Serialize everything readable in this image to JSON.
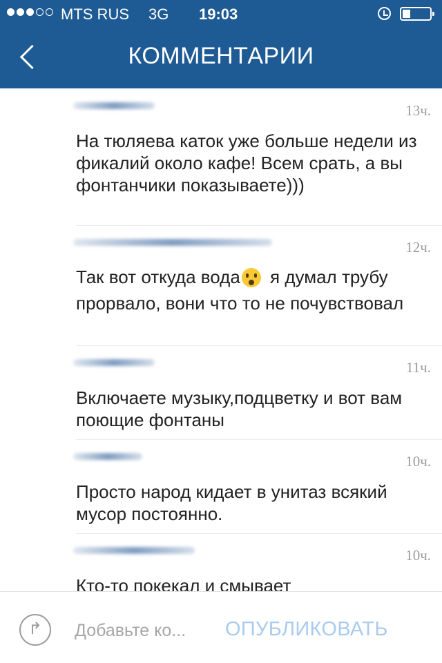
{
  "status_bar": {
    "carrier": "MTS RUS",
    "network": "3G",
    "time": "19:03",
    "signal_bars_filled": 3,
    "signal_bars_total": 5,
    "battery_fraction": 0.25
  },
  "header": {
    "title": "КОММЕНТАРИИ",
    "background_color": "#1e5a94"
  },
  "comments": [
    {
      "time_ago": "13ч.",
      "text": "На тюляева каток уже больше недели из фикалий около кафе! Всем срать, а вы фонтанчики показываете)))"
    },
    {
      "time_ago": "12ч.",
      "text_before_emoji": "Так вот откуда вода",
      "emoji": "hushed-face",
      "text_after_emoji": " я думал трубу прорвало, вони что то не почувствовал"
    },
    {
      "time_ago": "11ч.",
      "text": "Включаете музыку,подцветку и вот вам поющие фонтаны"
    },
    {
      "time_ago": "10ч.",
      "text": "Просто народ кидает в унитаз всякий мусор постоянно."
    },
    {
      "time_ago": "10ч.",
      "text": "Кто-то покекал и смывает"
    }
  ],
  "input_bar": {
    "placeholder": "Добавьте ко...",
    "publish_label": "ОПУБЛИКОВАТЬ",
    "share_icon": "share-arrow-icon",
    "publish_color": "#a9cbef"
  }
}
